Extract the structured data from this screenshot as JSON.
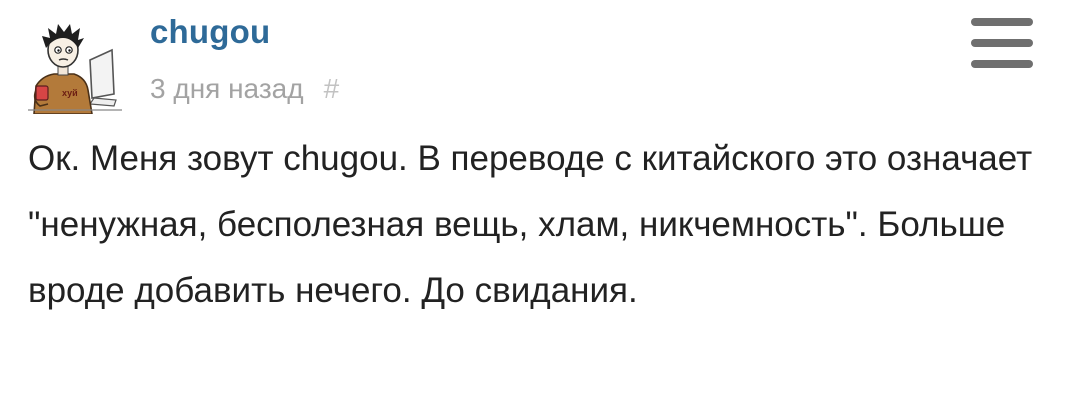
{
  "comment": {
    "author": {
      "username": "chugou",
      "avatar_icon": "user-avatar-drawing",
      "avatar_text": "хуй"
    },
    "timestamp": "3 дня назад",
    "permalink_label": "#",
    "menu_icon": "hamburger-menu-icon",
    "text": "Ок. Меня зовут chugou. В переводе с китайского это означает \"ненужная, бесполезная вещь, хлам, никчемность\". Больше вроде добавить нечего. До свидания."
  },
  "colors": {
    "username": "#2e6a98",
    "timestamp": "#a3a3a3",
    "text": "#222222",
    "menu_icon": "#6f6f6f"
  }
}
